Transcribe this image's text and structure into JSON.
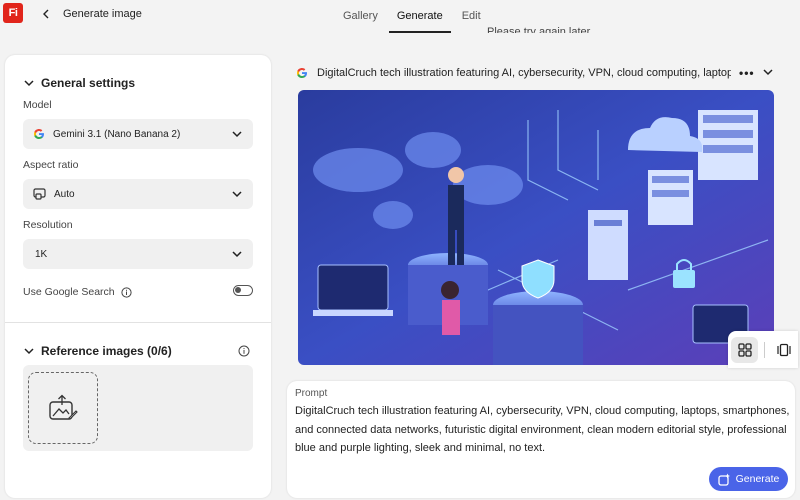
{
  "app": {
    "logo_text": "Fi",
    "title": "Generate image"
  },
  "tabs": [
    {
      "label": "Gallery",
      "active": false
    },
    {
      "label": "Generate",
      "active": true
    },
    {
      "label": "Edit",
      "active": false
    }
  ],
  "settings": {
    "section_title": "General settings",
    "model": {
      "label": "Model",
      "value": "Gemini 3.1 (Nano Banana 2)",
      "icon": "google-icon"
    },
    "aspect_ratio": {
      "label": "Aspect ratio",
      "value": "Auto",
      "icon": "aspect-ratio-icon"
    },
    "resolution": {
      "label": "Resolution",
      "value": "1K"
    },
    "google_search": {
      "label": "Use Google Search",
      "enabled": false
    }
  },
  "reference": {
    "title": "Reference images (0/6)"
  },
  "result": {
    "error_text": "Please try again later.",
    "prompt_summary": "DigitalCruch tech illustration featuring AI, cybersecurity, VPN, cloud computing, laptops, sm",
    "image_description_icon": "generated-image"
  },
  "prompt": {
    "label": "Prompt",
    "text": "DigitalCruch tech illustration featuring AI, cybersecurity, VPN, cloud computing, laptops, smartphones, and connected data networks, futuristic digital environment, clean modern editorial style, professional blue and purple lighting, sleek and minimal, no text.",
    "generate_label": "Generate"
  },
  "colors": {
    "accent": "#4a64e8",
    "brand": "#e1251b"
  }
}
